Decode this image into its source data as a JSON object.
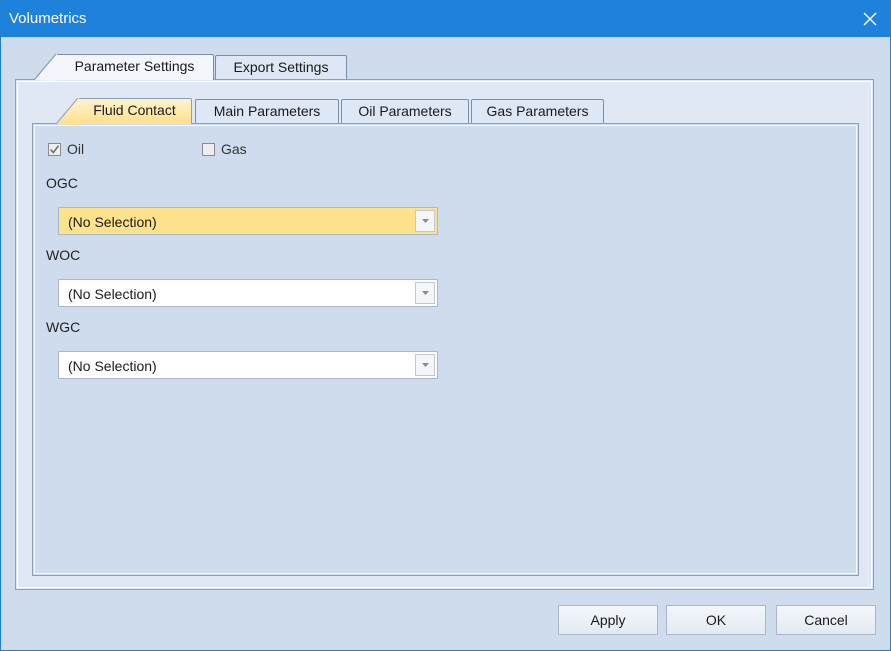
{
  "window": {
    "title": "Volumetrics",
    "accent_color": "#1e82dc",
    "close_icon": "close-icon"
  },
  "outer_tabs": [
    {
      "label": "Parameter Settings",
      "active": true
    },
    {
      "label": "Export Settings",
      "active": false
    }
  ],
  "inner_tabs": [
    {
      "label": "Fluid Contact",
      "active": true
    },
    {
      "label": "Main Parameters",
      "active": false
    },
    {
      "label": "Oil Parameters",
      "active": false
    },
    {
      "label": "Gas Parameters",
      "active": false
    }
  ],
  "fluid_contact": {
    "checkboxes": [
      {
        "label": "Oil",
        "checked": true
      },
      {
        "label": "Gas",
        "checked": false
      }
    ],
    "fields": [
      {
        "label": "OGC",
        "value": "(No Selection)",
        "focused": true
      },
      {
        "label": "WOC",
        "value": "(No Selection)",
        "focused": false
      },
      {
        "label": "WGC",
        "value": "(No Selection)",
        "focused": false
      }
    ]
  },
  "buttons": {
    "apply": "Apply",
    "ok": "OK",
    "cancel": "Cancel"
  }
}
